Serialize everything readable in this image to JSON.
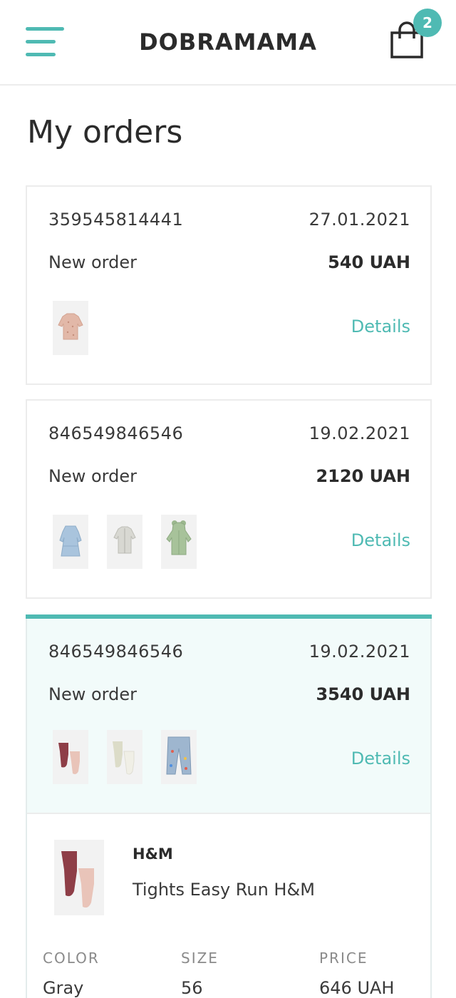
{
  "header": {
    "brand": "DOBRAMAMA",
    "cart_count": "2",
    "menu_icon": "hamburger-icon",
    "cart_icon": "shopping-bag-icon",
    "accent_color": "#4fbab3"
  },
  "page": {
    "title": "My orders"
  },
  "orders": [
    {
      "id": "359545814441",
      "date": "27.01.2021",
      "status": "New order",
      "total": "540 UAH",
      "details_label": "Details"
    },
    {
      "id": "846549846546",
      "date": "19.02.2021",
      "status": "New order",
      "total": "2120 UAH",
      "details_label": "Details"
    },
    {
      "id": "846549846546",
      "date": "19.02.2021",
      "status": "New order",
      "total": "3540 UAH",
      "details_label": "Details",
      "item": {
        "brand": "H&M",
        "name": "Tights Easy Run H&M",
        "color_label": "COLOR",
        "color_value": "Gray",
        "size_label": "SIZE",
        "size_value": "56",
        "price_label": "PRICE",
        "price_value": "646 UAH"
      }
    }
  ]
}
